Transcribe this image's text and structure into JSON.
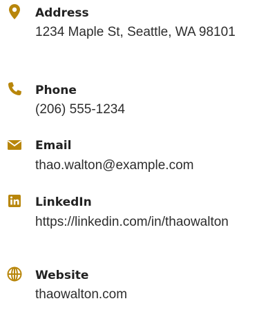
{
  "accent_color": "#B8860B",
  "contacts": {
    "items": [
      {
        "icon": "location-pin-icon",
        "label": "Address",
        "value": "1234 Maple St, Seattle, WA 98101"
      },
      {
        "icon": "phone-icon",
        "label": "Phone",
        "value": "(206) 555-1234"
      },
      {
        "icon": "envelope-icon",
        "label": "Email",
        "value": "thao.walton@example.com"
      },
      {
        "icon": "linkedin-icon",
        "label": "LinkedIn",
        "value": "https://linkedin.com/in/thaowalton"
      },
      {
        "icon": "globe-icon",
        "label": "Website",
        "value": "thaowalton.com"
      }
    ]
  }
}
